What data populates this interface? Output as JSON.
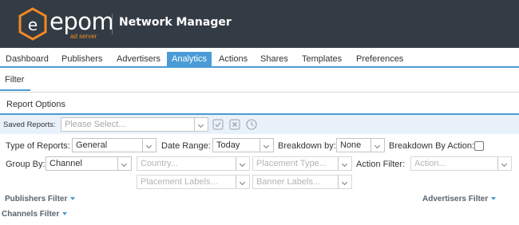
{
  "header": {
    "logo_text": "epom",
    "logo_sub": "ad server",
    "title": "Network Manager"
  },
  "nav": {
    "items": [
      "Dashboard",
      "Publishers",
      "Advertisers",
      "Analytics",
      "Actions",
      "Shares",
      "Templates",
      "Preferences"
    ],
    "active": "Analytics"
  },
  "subnav": {
    "filter_label": "Filter"
  },
  "report_options": {
    "title": "Report Options",
    "saved_reports_label": "Saved Reports:",
    "saved_reports_placeholder": "Please Select...",
    "type_label": "Type of Reports:",
    "type_value": "General",
    "date_range_label": "Date Range:",
    "date_range_value": "Today",
    "breakdown_label": "Breakdown by:",
    "breakdown_value": "None",
    "breakdown_action_label": "Breakdown By Action:",
    "group_by_label": "Group By:",
    "group_by_value": "Channel",
    "country_placeholder": "Country...",
    "placement_type_placeholder": "Placement Type...",
    "action_filter_label": "Action Filter:",
    "action_placeholder": "Action...",
    "placement_labels_placeholder": "Placement Labels...",
    "banner_labels_placeholder": "Banner Labels..."
  },
  "filters": {
    "publishers": "Publishers Filter",
    "advertisers": "Advertisers Filter",
    "channels": "Channels Filter"
  },
  "colors": {
    "header_bg": "#333b44",
    "accent": "#4a9bd6",
    "logo_orange": "#f08a24"
  }
}
